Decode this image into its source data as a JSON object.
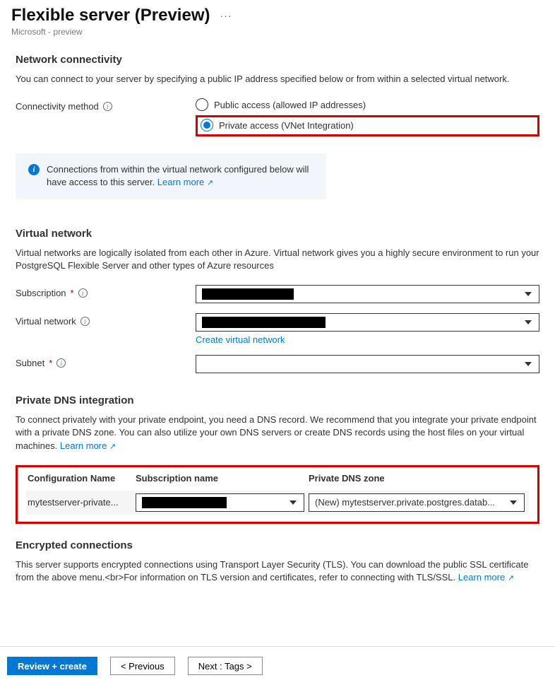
{
  "header": {
    "title": "Flexible server (Preview)",
    "subtitle": "Microsoft - preview"
  },
  "network": {
    "heading": "Network connectivity",
    "description": "You can connect to your server by specifying a public IP address specified below or from within a selected virtual network.",
    "method_label": "Connectivity method",
    "option_public": "Public access (allowed IP addresses)",
    "option_private": "Private access (VNet Integration)",
    "info_text": "Connections from within the virtual network configured below will have access to this server. ",
    "learn_more": "Learn more"
  },
  "vnet": {
    "heading": "Virtual network",
    "description": "Virtual networks are logically isolated from each other in Azure. Virtual network gives you a highly secure environment to run your PostgreSQL Flexible Server and other types of Azure resources",
    "subscription_label": "Subscription",
    "vnet_label": "Virtual network",
    "create_link": "Create virtual network",
    "subnet_label": "Subnet"
  },
  "dns": {
    "heading": "Private DNS integration",
    "description": "To connect privately with your private endpoint, you need a DNS record. We recommend that you integrate your private endpoint with a private DNS zone. You can also utilize your own DNS servers or create DNS records using the host files on your virtual machines. ",
    "learn_more": "Learn more",
    "col_config": "Configuration Name",
    "col_sub": "Subscription name",
    "col_zone": "Private DNS zone",
    "row_config": "mytestserver-private...",
    "row_zone": "(New) mytestserver.private.postgres.datab..."
  },
  "encrypted": {
    "heading": "Encrypted connections",
    "description": "This server supports encrypted connections using Transport Layer Security (TLS). You can download the public SSL certificate from the above menu.<br>For information on TLS version and certificates, refer to connecting with TLS/SSL. ",
    "learn_more": "Learn more"
  },
  "footer": {
    "review": "Review + create",
    "previous": "< Previous",
    "next": "Next : Tags >"
  }
}
